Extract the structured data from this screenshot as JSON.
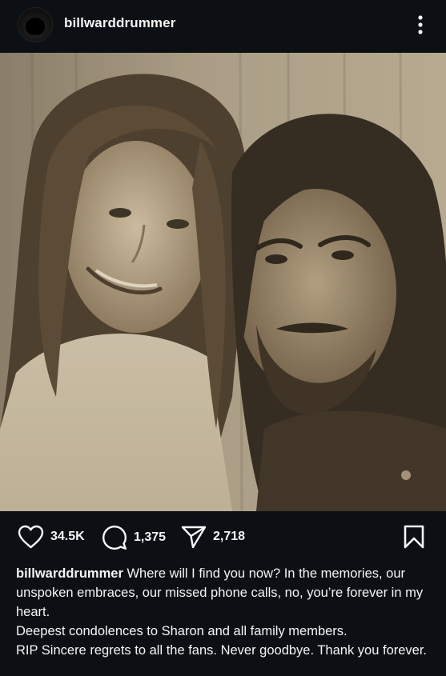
{
  "header": {
    "username": "billwarddrummer",
    "avatar_icon": "profile-avatar",
    "more_icon": "vertical-ellipsis-icon"
  },
  "post": {
    "photo_description_icon": "photo",
    "likes": "34.5K",
    "comments": "1,375",
    "shares": "2,718"
  },
  "caption": {
    "username": "billwarddrummer",
    "line1": "Where will I find you now?  In the memories, our unspoken embraces, our missed phone calls, no, you’re forever in my heart.",
    "line2": "Deepest condolences to Sharon and all family members.",
    "line3": "RIP Sincere regrets to all the fans. Never goodbye. Thank you forever."
  },
  "colors": {
    "background": "#0c1014",
    "text": "#f5f5f5"
  }
}
